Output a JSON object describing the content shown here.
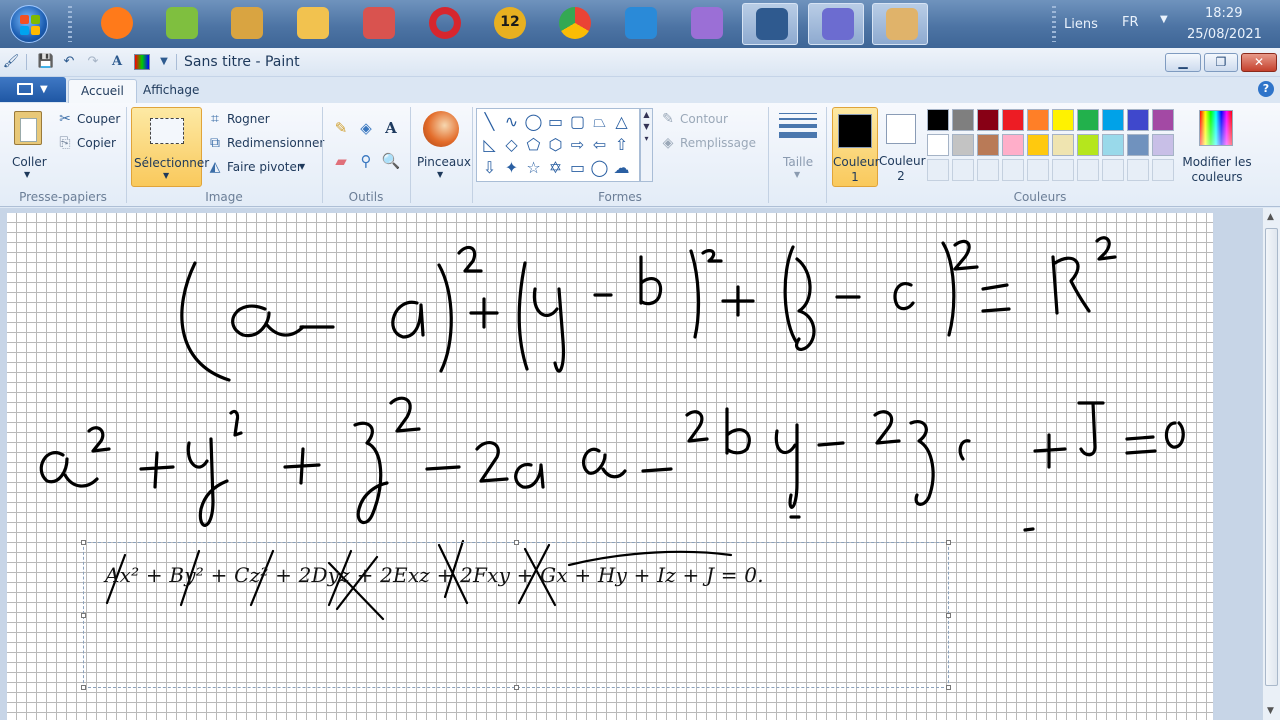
{
  "taskbar": {
    "apps": [
      {
        "icon": "firefox-icon",
        "color": "#ff7a1a"
      },
      {
        "icon": "calculator-icon",
        "color": "#7fbf3f"
      },
      {
        "icon": "tools-icon",
        "color": "#d9a441"
      },
      {
        "icon": "folder-icon",
        "color": "#f2c24f"
      },
      {
        "icon": "snipping-tool-icon",
        "color": "#d9534f"
      },
      {
        "icon": "opera-icon",
        "color": "#d7262e"
      },
      {
        "icon": "app-12-icon",
        "color": "#e8b020"
      },
      {
        "icon": "chrome-icon",
        "color": "#34a853"
      },
      {
        "icon": "internet-explorer-icon",
        "color": "#2a8ad8"
      },
      {
        "icon": "video-editor-icon",
        "color": "#9b6fd6"
      },
      {
        "icon": "recorder-icon",
        "color": "#2f5a8f"
      },
      {
        "icon": "geogebra-icon",
        "color": "#6c6cd0"
      },
      {
        "icon": "paint-icon",
        "color": "#e0b36a"
      }
    ],
    "app12_label": "12",
    "links_label": "Liens",
    "language": "FR",
    "time": "18:29",
    "date": "25/08/2021"
  },
  "window": {
    "title": "Sans titre - Paint",
    "minimize": "▁",
    "maximize": "❐",
    "close": "✕"
  },
  "tabs": {
    "home": "Accueil",
    "view": "Affichage"
  },
  "ribbon": {
    "clipboard": {
      "paste": "Coller",
      "cut": "Couper",
      "copy": "Copier",
      "label": "Presse-papiers"
    },
    "image": {
      "select": "Sélectionner",
      "crop": "Rogner",
      "resize": "Redimensionner",
      "rotate": "Faire pivoter",
      "label": "Image"
    },
    "tools": {
      "label": "Outils"
    },
    "brushes": {
      "label": "Pinceaux"
    },
    "shapes": {
      "outline": "Contour",
      "fill": "Remplissage",
      "label": "Formes"
    },
    "size": {
      "label": "Taille"
    },
    "colors": {
      "color1": "Couleur 1",
      "color1_value": "#000000",
      "color2": "Couleur 2",
      "color2_value": "#ffffff",
      "edit": "Modifier les couleurs",
      "label": "Couleurs",
      "palette": [
        "#000000",
        "#7f7f7f",
        "#880015",
        "#ed1c24",
        "#ff7f27",
        "#fff200",
        "#22b14c",
        "#00a2e8",
        "#3f48cc",
        "#a349a4",
        "#ffffff",
        "#c3c3c3",
        "#b97a57",
        "#ffaec9",
        "#ffc90e",
        "#efe4b0",
        "#b5e61d",
        "#99d9ea",
        "#7092be",
        "#c8bfe7"
      ]
    }
  },
  "canvas": {
    "formula": "Ax² + By² + Cz² + 2Dyz + 2Exz + 2Fxy + Gx + Hy + Iz + J = 0."
  }
}
